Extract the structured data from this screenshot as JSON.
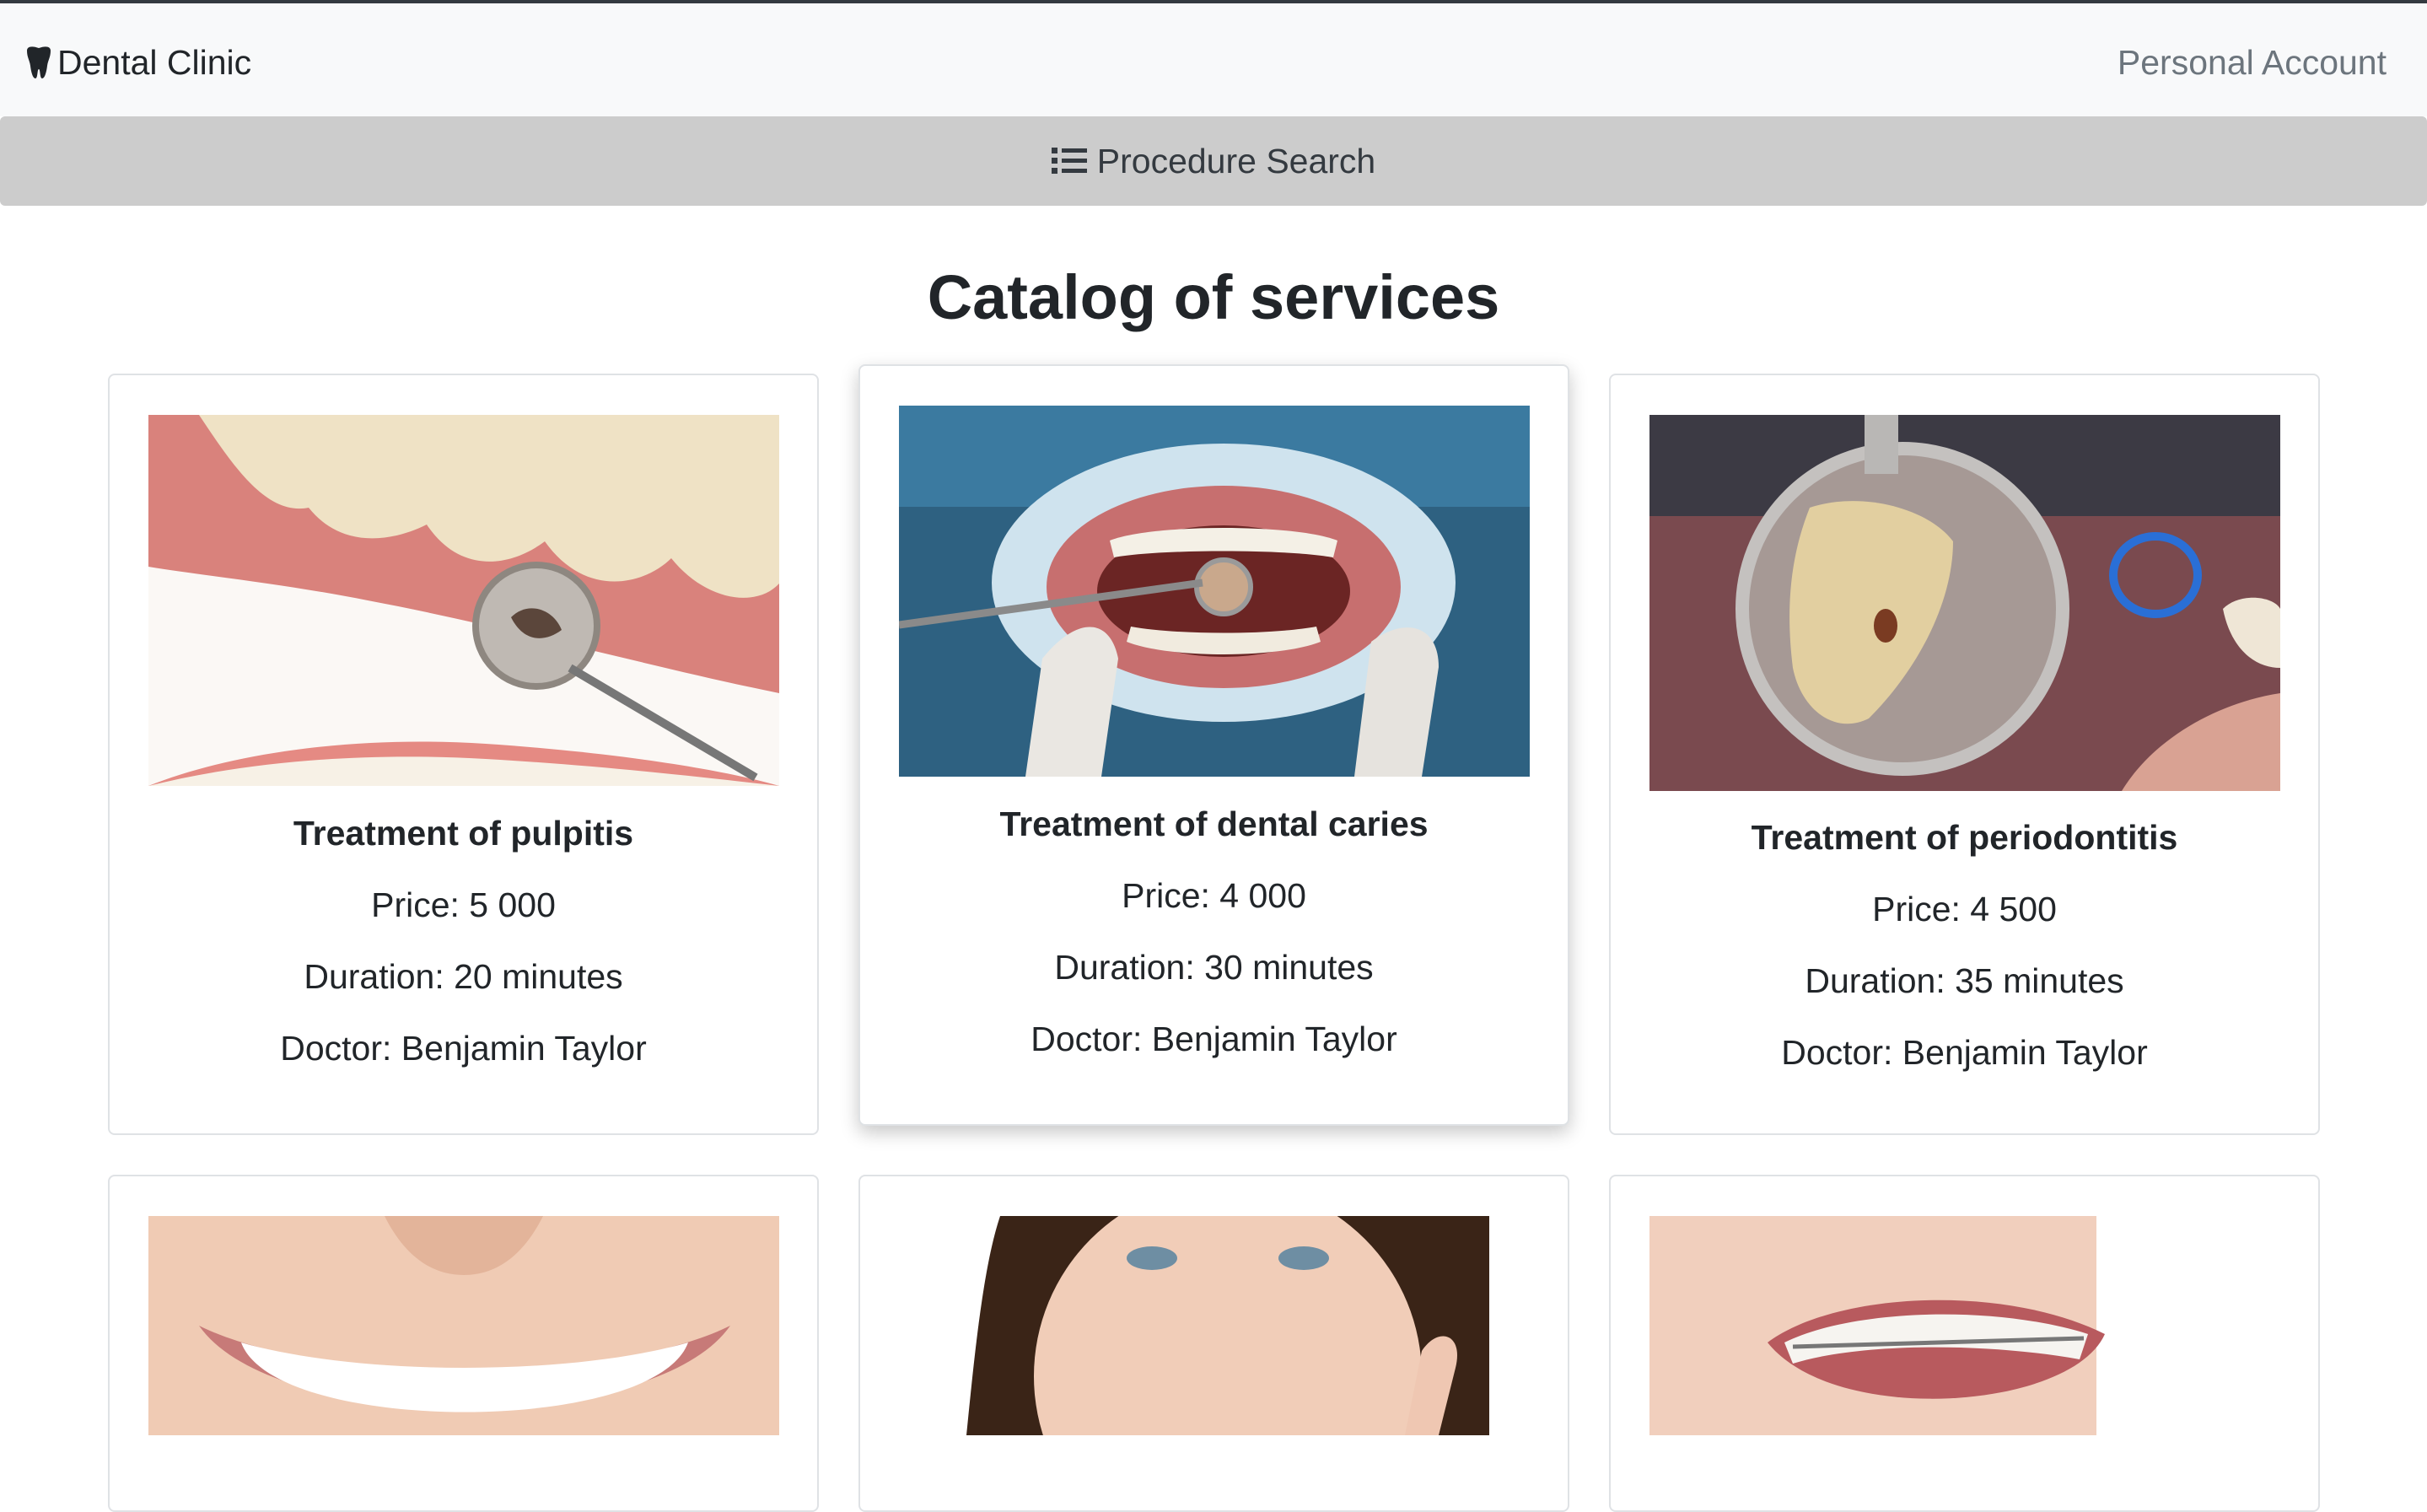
{
  "navbar": {
    "brand": "Dental Clinic",
    "brand_icon": "tooth-icon",
    "account_link": "Personal Account"
  },
  "search": {
    "label": "Procedure Search",
    "icon": "list-icon"
  },
  "catalog": {
    "title": "Catalog of services",
    "services": [
      {
        "name": "Treatment of pulpitis",
        "price": "Price: 5 000",
        "duration": "Duration: 20 minutes",
        "doctor": "Doctor: Benjamin Taylor"
      },
      {
        "name": "Treatment of dental caries",
        "price": "Price: 4 000",
        "duration": "Duration: 30 minutes",
        "doctor": "Doctor: Benjamin Taylor"
      },
      {
        "name": "Treatment of periodontitis",
        "price": "Price: 4 500",
        "duration": "Duration: 35 minutes",
        "doctor": "Doctor: Benjamin Taylor"
      }
    ]
  },
  "colors": {
    "navbar_bg": "#f8f9fa",
    "search_bg": "#cccccc",
    "text": "#212529",
    "muted": "#6c757d"
  }
}
